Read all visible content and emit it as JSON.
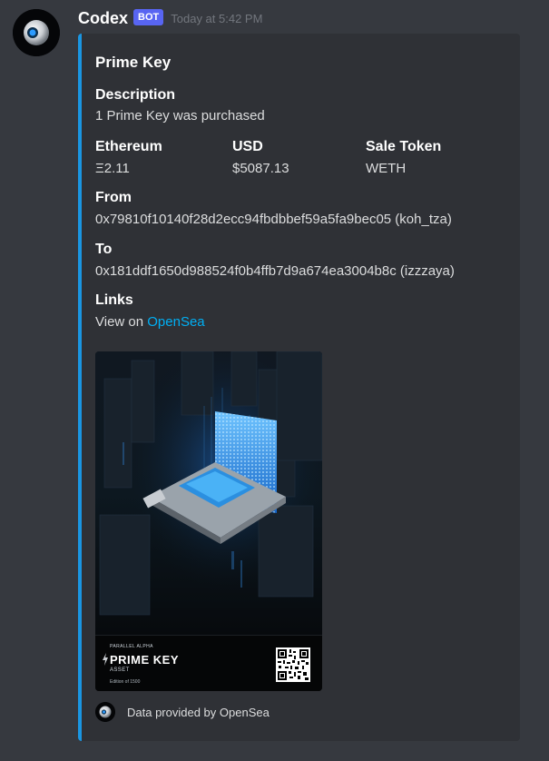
{
  "message": {
    "username": "Codex",
    "bot_tag": "BOT",
    "timestamp": "Today at 5:42 PM"
  },
  "embed": {
    "accent_color": "#1a96e2",
    "title": "Prime Key",
    "description_label": "Description",
    "description_value": "1 Prime Key was purchased",
    "ethereum_label": "Ethereum",
    "ethereum_value": "Ξ2.11",
    "usd_label": "USD",
    "usd_value": "$5087.13",
    "sale_token_label": "Sale Token",
    "sale_token_value": "WETH",
    "from_label": "From",
    "from_value": "0x79810f10140f28d2ecc94fbdbbef59a5fa9bec05 (koh_tza)",
    "to_label": "To",
    "to_value": "0x181ddf1650d988524f0b4ffb7d9a674ea3004b8c (izzzaya)",
    "links_label": "Links",
    "links_prefix": "View on ",
    "links_link_text": "OpenSea",
    "image": {
      "subtitle": "PARALLEL ALPHA",
      "name": "PRIME KEY",
      "type": "ASSET",
      "edition": "Edition of 1500"
    },
    "footer_text": "Data provided by OpenSea"
  },
  "icons": {
    "avatar": "orb-avatar-icon",
    "footer": "orb-footer-icon",
    "qr": "qr-code-icon"
  }
}
